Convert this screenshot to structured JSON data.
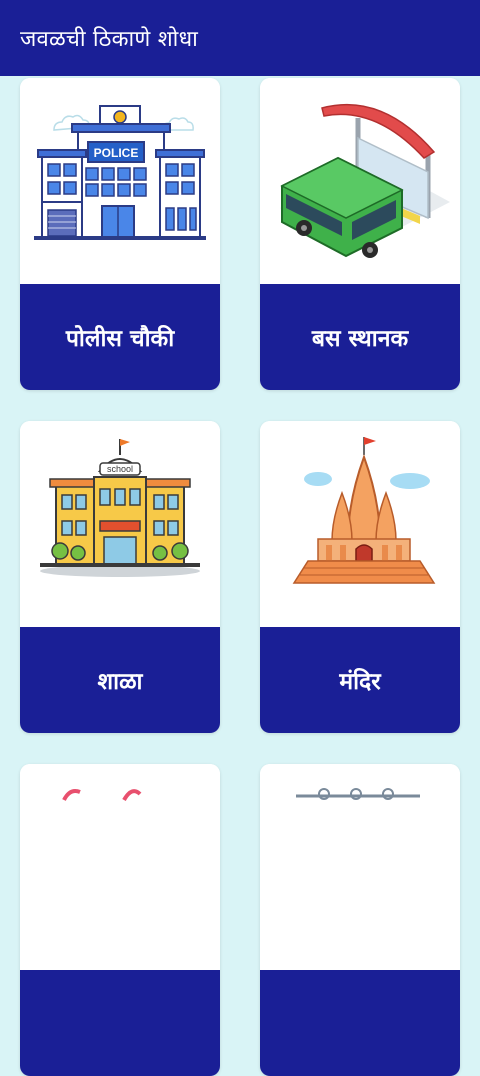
{
  "appbar": {
    "title": "जवळची ठिकाणे शोधा"
  },
  "cards": [
    {
      "label": "पोलीस चौकी",
      "sign": "POLICE",
      "icon": "police-station-icon"
    },
    {
      "label": "बस स्थानक",
      "icon": "bus-stop-icon"
    },
    {
      "label": "शाळा",
      "sign": "school",
      "icon": "school-icon"
    },
    {
      "label": "मंदिर",
      "icon": "temple-icon"
    },
    {
      "label": "",
      "icon": "hospital-icon"
    },
    {
      "label": "",
      "icon": "bank-icon"
    }
  ],
  "colors": {
    "appbar": "#1a1f96",
    "background": "#d9f4f6",
    "card_label_bg": "#1a1f96"
  }
}
